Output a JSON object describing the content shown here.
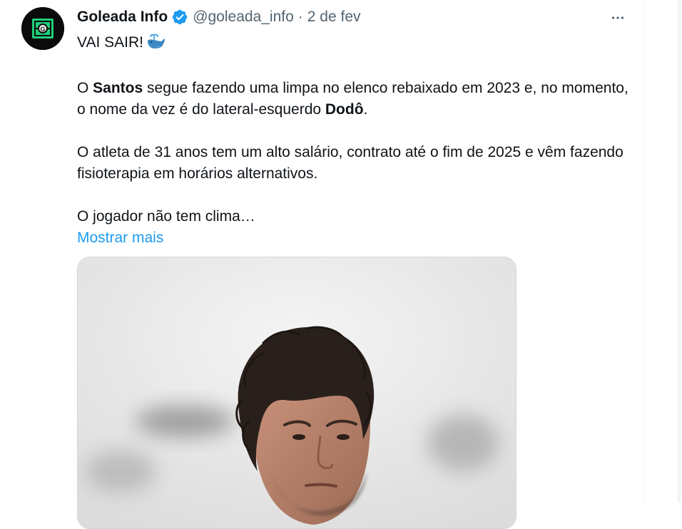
{
  "tweet": {
    "author_name": "Goleada Info",
    "handle": "@goleada_info",
    "separator": "·",
    "date": "2 de fev",
    "avatar_icon": "goleada-logo-icon",
    "verified_icon": "verified-badge-icon",
    "more_icon": "more-options-icon",
    "text": {
      "line1": "VAI SAIR!",
      "emoji_icon": "whale-emoji-icon",
      "p2_a": "O ",
      "p2_b": "Santos",
      "p2_c": " segue fazendo uma limpa no elenco rebaixado em 2023 e, no momento, o nome da vez é do lateral-esquerdo ",
      "p2_d": "Dodô",
      "p2_e": ".",
      "p3": "O atleta de 31 anos tem um alto salário, contrato até o fim de 2025 e vêm fazendo fisioterapia em horários alternativos.",
      "p4": "O jogador não tem clima…"
    },
    "show_more": "Mostrar mais"
  },
  "colors": {
    "text": "#0f1419",
    "secondary": "#536471",
    "link": "#1d9bf0",
    "verified": "#1d9bf0"
  }
}
